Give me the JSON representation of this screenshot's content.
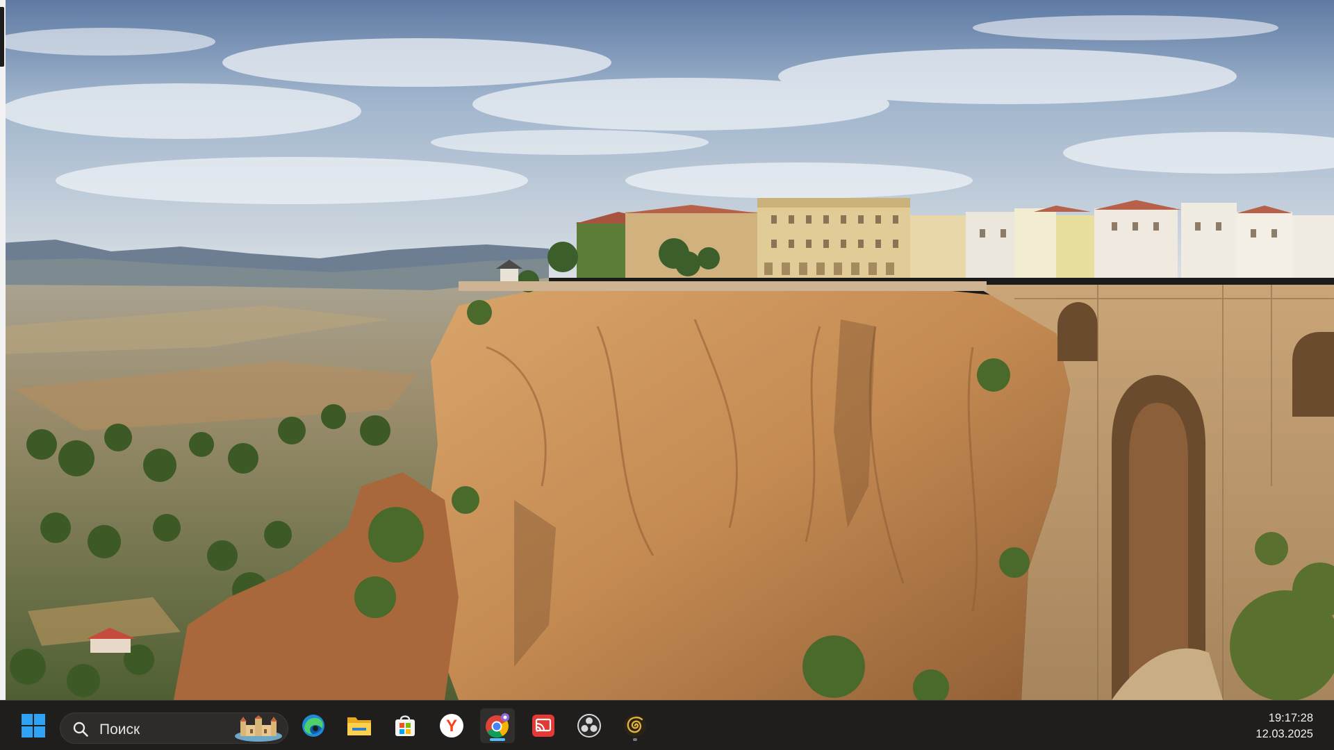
{
  "desktop": {
    "wallpaper_icon": "ronda-cliff-landscape"
  },
  "taskbar": {
    "start_icon": "windows-logo-icon",
    "search": {
      "label": "Поиск",
      "icon": "search-icon",
      "highlight_icon": "castle-illustration-icon"
    },
    "apps": [
      {
        "name": "Microsoft Edge",
        "icon": "edge-icon",
        "running": false
      },
      {
        "name": "File Explorer",
        "icon": "folder-icon",
        "running": false
      },
      {
        "name": "Microsoft Store",
        "icon": "store-icon",
        "running": false
      },
      {
        "name": "Yandex Browser",
        "icon": "yandex-icon",
        "running": false
      },
      {
        "name": "Google Chrome",
        "icon": "chrome-icon",
        "running": true,
        "active": true
      },
      {
        "name": "Cast App",
        "icon": "cast-icon",
        "running": false
      },
      {
        "name": "OBS Studio",
        "icon": "obs-icon",
        "running": false
      },
      {
        "name": "Spiral App",
        "icon": "spiral-icon",
        "running": true,
        "active": false
      }
    ],
    "clock": {
      "time": "19:17:28",
      "date": "12.03.2025"
    },
    "colors": {
      "background": "#1f1e1d",
      "active_indicator": "#4cc2ff",
      "inactive_indicator": "#7a7a7a"
    }
  }
}
